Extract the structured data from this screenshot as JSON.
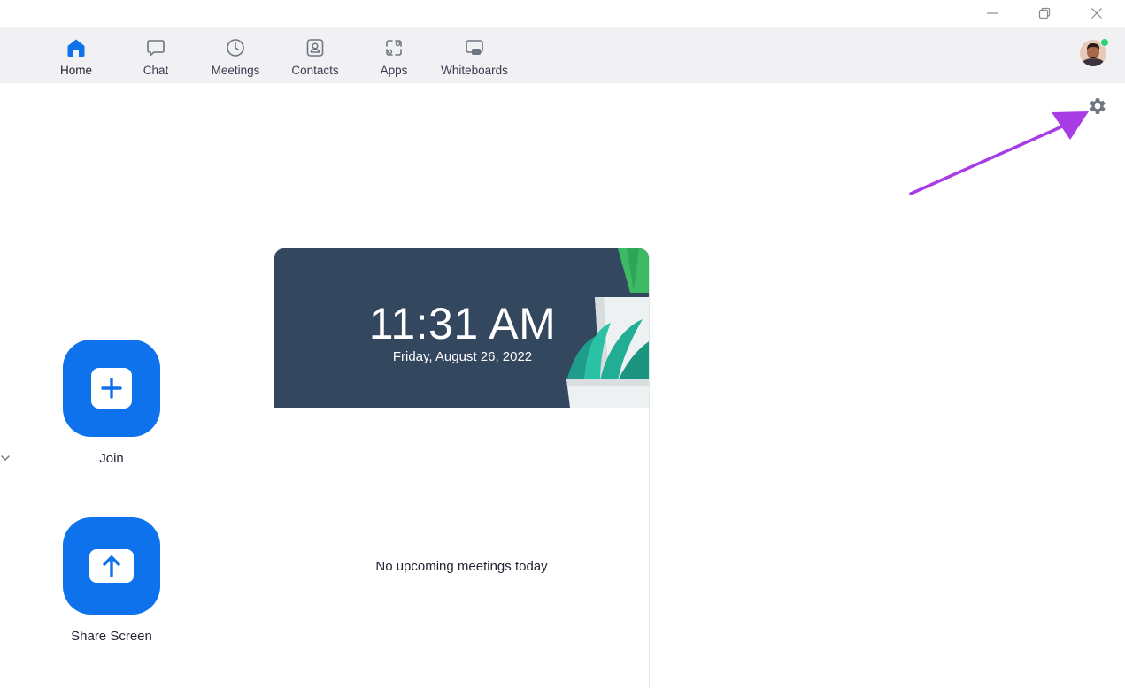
{
  "window_controls": {
    "minimize_icon": "minimize-icon",
    "restore_icon": "restore-icon",
    "close_icon": "close-icon"
  },
  "nav": {
    "items": [
      {
        "label": "Home",
        "icon": "home-icon",
        "active": true
      },
      {
        "label": "Chat",
        "icon": "chat-icon"
      },
      {
        "label": "Meetings",
        "icon": "clock-icon"
      },
      {
        "label": "Contacts",
        "icon": "contacts-icon"
      },
      {
        "label": "Apps",
        "icon": "apps-icon"
      },
      {
        "label": "Whiteboards",
        "icon": "whiteboard-icon"
      }
    ],
    "avatar_status": "online"
  },
  "settings_icon": "gear-icon",
  "actions": {
    "join_label": "Join",
    "share_label": "Share Screen"
  },
  "meetings_panel": {
    "time": "11:31 AM",
    "date": "Friday, August 26, 2022",
    "empty_message": "No upcoming meetings today"
  },
  "colors": {
    "accent": "#0e72ed",
    "nav_bg": "#f1f1f4",
    "header_bg": "#33475e",
    "annotation_arrow": "#a83ce6",
    "status_online": "#2bd36a"
  }
}
